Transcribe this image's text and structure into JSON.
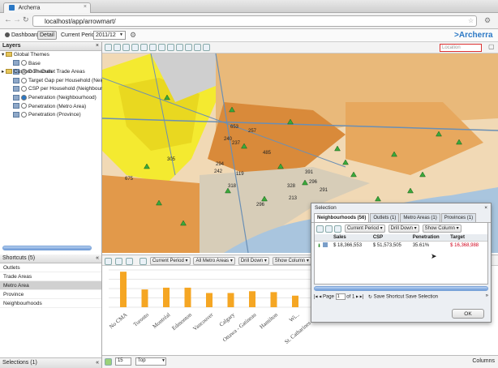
{
  "browser": {
    "tab_title": "Archerra",
    "url": "localhost/app/arrowmart/"
  },
  "appbar": {
    "dashboard_label": "Dashboard",
    "detail_label": "Detail",
    "current_period_label": "Current Period:",
    "current_period_value": "2011/12",
    "brand": "Archerra"
  },
  "map_toolbar": {
    "location_placeholder": "Location"
  },
  "layers": {
    "title": "Layers",
    "groups": [
      {
        "label": "Global Themes"
      },
      {
        "label": "Custom Themes"
      }
    ],
    "items": [
      {
        "label": "Base",
        "checked": false
      },
      {
        "label": "Dom Outlet Trade Areas",
        "checked": false
      },
      {
        "label": "Target Gap per Household (Neighbourh",
        "checked": false
      },
      {
        "label": "CSP per Household (Neighbourhood)",
        "checked": false
      },
      {
        "label": "Penetration (Neighbourhood)",
        "checked": true
      },
      {
        "label": "Penetration (Metro Area)",
        "checked": false
      },
      {
        "label": "Penetration (Province)",
        "checked": false
      }
    ]
  },
  "shortcuts": {
    "title": "Shortcuts (5)",
    "items": [
      "Outlets",
      "Trade Areas",
      "Metro Area",
      "Province",
      "Neighbourhoods"
    ],
    "selected": "Metro Area"
  },
  "selections": {
    "label": "Selections (1)"
  },
  "chart_toolbar": {
    "current_period": "Current Period",
    "all_metro_areas": "All Metro Areas",
    "drill_down": "Drill Down",
    "show_column": "Show Column"
  },
  "chart_bottom": {
    "zoom_value": "15",
    "top_value": "Top",
    "columns_label": "Columns"
  },
  "chart_data": {
    "type": "bar",
    "categories": [
      "No CMA",
      "Toronto",
      "Montréal",
      "Edmonton",
      "Vancouver",
      "Calgary",
      "Ottawa - Gatineau",
      "Hamilton",
      "Wi...",
      "St. Catharines - N...",
      "Kit..."
    ],
    "values": [
      4.0,
      2.0,
      2.2,
      2.2,
      1.6,
      1.6,
      1.8,
      1.7,
      1.3,
      1.2,
      1.1
    ],
    "ylim": [
      0,
      4.2
    ],
    "color": "#f5a623",
    "grid": true
  },
  "map": {
    "labels": [
      "653",
      "257",
      "240",
      "237",
      "485",
      "305",
      "294",
      "242",
      "119",
      "675",
      "318",
      "328",
      "213",
      "296",
      "391",
      "296",
      "291"
    ]
  },
  "selection_dialog": {
    "title": "Selection",
    "tabs": [
      "Neighbourhoods (56)",
      "Outlets (1)",
      "Metro Areas (1)",
      "Provinces (1)"
    ],
    "toolbar": {
      "current_period": "Current Period",
      "drill_down": "Drill Down",
      "show_column": "Show Column"
    },
    "columns": [
      "Sales",
      "CSP",
      "Penetration",
      "Target"
    ],
    "row": {
      "sales": "$ 18,366,553",
      "csp": "$ 51,573,505",
      "penetration": "35.61%",
      "target": "$ 16,368,988"
    },
    "target_color": "#d0021b",
    "pager": {
      "page_label": "Page",
      "page_value": "1",
      "of_label": "of 1"
    },
    "save_shortcut": "Save Shortcut",
    "save_selection": "Save Selection",
    "ok": "OK"
  }
}
